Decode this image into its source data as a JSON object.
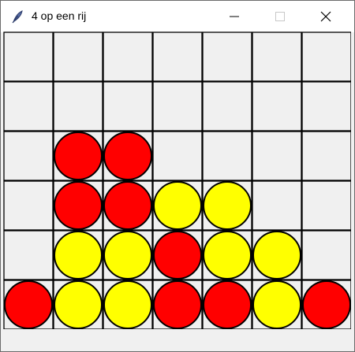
{
  "window": {
    "title": "4 op een rij",
    "app_icon": "feather-icon",
    "controls": [
      "minimize-icon",
      "maximize-icon",
      "close-icon"
    ]
  },
  "colors": {
    "red": "#ff0000",
    "yellow": "#ffff00",
    "cell_background": "#f0f0f0",
    "grid_line": "#000000"
  },
  "board": {
    "columns": 7,
    "rows": 6,
    "cells": [
      [
        "empty",
        "empty",
        "empty",
        "empty",
        "empty",
        "empty",
        "empty"
      ],
      [
        "empty",
        "empty",
        "empty",
        "empty",
        "empty",
        "empty",
        "empty"
      ],
      [
        "empty",
        "red",
        "red",
        "empty",
        "empty",
        "empty",
        "empty"
      ],
      [
        "empty",
        "red",
        "red",
        "yellow",
        "yellow",
        "empty",
        "empty"
      ],
      [
        "empty",
        "yellow",
        "yellow",
        "red",
        "yellow",
        "yellow",
        "empty"
      ],
      [
        "red",
        "yellow",
        "yellow",
        "red",
        "red",
        "yellow",
        "red"
      ]
    ]
  }
}
